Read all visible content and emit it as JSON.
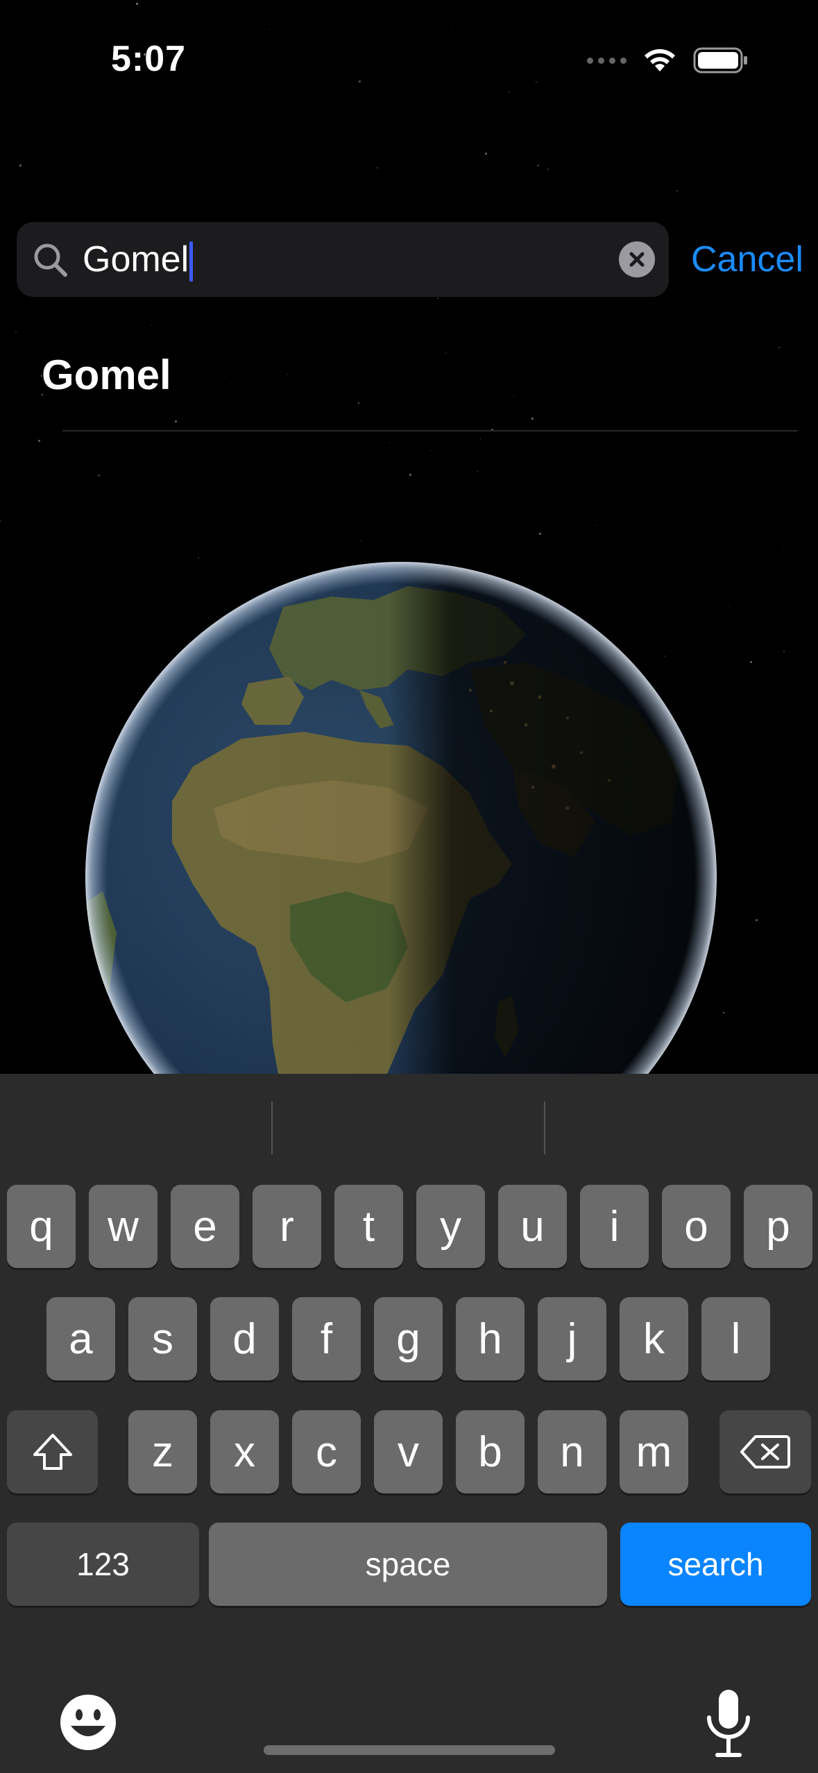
{
  "status_bar": {
    "time": "5:07"
  },
  "search": {
    "query": "Gomel",
    "cancel_label": "Cancel"
  },
  "results": [
    {
      "label": "Gomel"
    }
  ],
  "keyboard": {
    "row1": [
      "q",
      "w",
      "e",
      "r",
      "t",
      "y",
      "u",
      "i",
      "o",
      "p"
    ],
    "row2": [
      "a",
      "s",
      "d",
      "f",
      "g",
      "h",
      "j",
      "k",
      "l"
    ],
    "row3": [
      "z",
      "x",
      "c",
      "v",
      "b",
      "n",
      "m"
    ],
    "numbers_label": "123",
    "space_label": "space",
    "search_label": "search",
    "accent_color": "#0a84ff"
  },
  "icons": {
    "search": "search-icon",
    "clear": "clear-text-icon",
    "wifi": "wifi-icon",
    "battery": "battery-icon",
    "shift": "shift-icon",
    "delete": "delete-icon",
    "emoji": "emoji-icon",
    "dictation": "microphone-icon"
  }
}
